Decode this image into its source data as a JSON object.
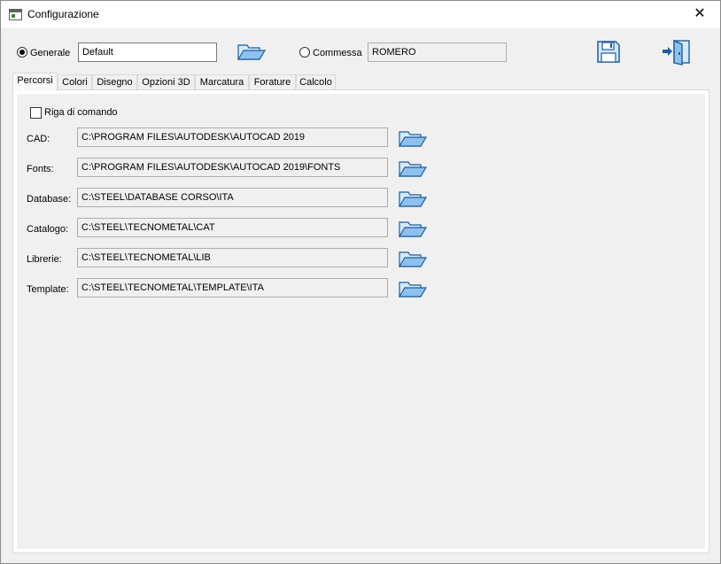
{
  "window": {
    "title": "Configurazione",
    "close_symbol": "✕"
  },
  "top": {
    "generale_label": "Generale",
    "generale_value": "Default",
    "commessa_label": "Commessa",
    "commessa_value": "ROMERO",
    "selected": "generale"
  },
  "tabs": [
    {
      "label": "Percorsi",
      "active": true
    },
    {
      "label": "Colori"
    },
    {
      "label": "Disegno"
    },
    {
      "label": "Opzioni 3D"
    },
    {
      "label": "Marcatura"
    },
    {
      "label": "Forature"
    },
    {
      "label": "Calcolo"
    }
  ],
  "percorsi": {
    "command_line_label": "Riga di comando",
    "command_line_checked": false,
    "paths": [
      {
        "label": "CAD:",
        "value": "C:\\PROGRAM FILES\\AUTODESK\\AUTOCAD 2019"
      },
      {
        "label": "Fonts:",
        "value": "C:\\PROGRAM FILES\\AUTODESK\\AUTOCAD 2019\\FONTS"
      },
      {
        "label": "Database:",
        "value": "C:\\STEEL\\DATABASE CORSO\\ITA"
      },
      {
        "label": "Catalogo:",
        "value": "C:\\STEEL\\TECNOMETAL\\CAT"
      },
      {
        "label": "Librerie:",
        "value": "C:\\STEEL\\TECNOMETAL\\LIB"
      },
      {
        "label": "Template:",
        "value": "C:\\STEEL\\TECNOMETAL\\TEMPLATE\\ITA"
      }
    ]
  },
  "icons": {
    "folder": "folder-open-icon",
    "save": "save-icon",
    "exit": "exit-door-icon"
  },
  "colors": {
    "icon_blue": "#2f7ec9",
    "icon_fill": "#d6e9fb",
    "icon_stroke": "#1c5e9c"
  }
}
